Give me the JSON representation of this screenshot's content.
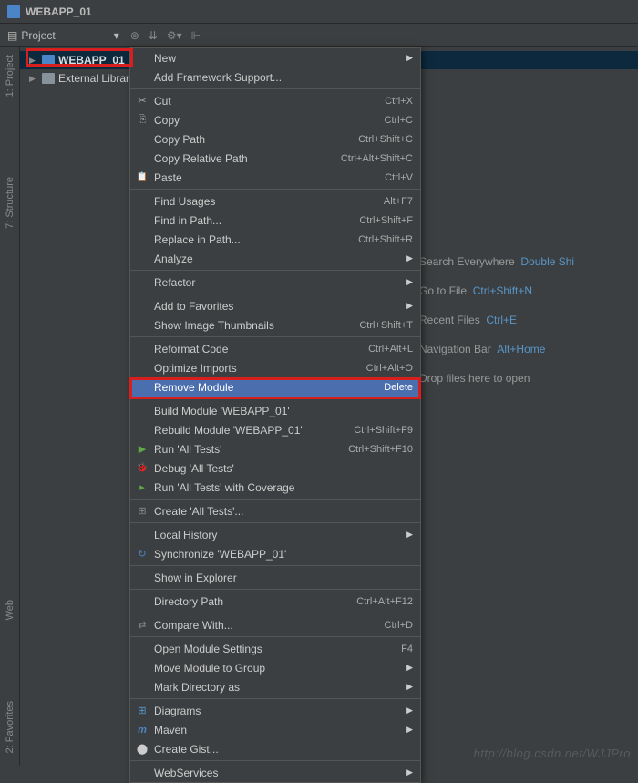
{
  "titlebar": {
    "title": "WEBAPP_01"
  },
  "toolbar": {
    "project_label": "Project"
  },
  "tree": {
    "module": "WEBAPP_01",
    "external": "External Librar"
  },
  "gutter": {
    "project": "1: Project",
    "structure": "7: Structure",
    "web": "Web",
    "favorites": "2: Favorites"
  },
  "content": {
    "search": "Search Everywhere",
    "search_sc": "Double Shi",
    "goto": "Go to File",
    "goto_sc": "Ctrl+Shift+N",
    "recent": "Recent Files",
    "recent_sc": "Ctrl+E",
    "nav": "Navigation Bar",
    "nav_sc": "Alt+Home",
    "drop": "Drop files here to open"
  },
  "menu": {
    "new": "New",
    "addfw": "Add Framework Support...",
    "cut": "Cut",
    "cut_sc": "Ctrl+X",
    "copy": "Copy",
    "copy_sc": "Ctrl+C",
    "copypath": "Copy Path",
    "copypath_sc": "Ctrl+Shift+C",
    "copyrel": "Copy Relative Path",
    "copyrel_sc": "Ctrl+Alt+Shift+C",
    "paste": "Paste",
    "paste_sc": "Ctrl+V",
    "findusages": "Find Usages",
    "findusages_sc": "Alt+F7",
    "findpath": "Find in Path...",
    "findpath_sc": "Ctrl+Shift+F",
    "replacepath": "Replace in Path...",
    "replacepath_sc": "Ctrl+Shift+R",
    "analyze": "Analyze",
    "refactor": "Refactor",
    "addfav": "Add to Favorites",
    "thumbs": "Show Image Thumbnails",
    "thumbs_sc": "Ctrl+Shift+T",
    "reformat": "Reformat Code",
    "reformat_sc": "Ctrl+Alt+L",
    "optimize": "Optimize Imports",
    "optimize_sc": "Ctrl+Alt+O",
    "remove": "Remove Module",
    "remove_sc": "Delete",
    "build": "Build Module 'WEBAPP_01'",
    "rebuild": "Rebuild Module 'WEBAPP_01'",
    "rebuild_sc": "Ctrl+Shift+F9",
    "run": "Run 'All Tests'",
    "run_sc": "Ctrl+Shift+F10",
    "debug": "Debug 'All Tests'",
    "cov": "Run 'All Tests' with Coverage",
    "create": "Create 'All Tests'...",
    "localhist": "Local History",
    "sync": "Synchronize 'WEBAPP_01'",
    "explorer": "Show in Explorer",
    "dirpath": "Directory Path",
    "dirpath_sc": "Ctrl+Alt+F12",
    "compare": "Compare With...",
    "compare_sc": "Ctrl+D",
    "modsettings": "Open Module Settings",
    "modsettings_sc": "F4",
    "movegroup": "Move Module to Group",
    "markdir": "Mark Directory as",
    "diagrams": "Diagrams",
    "maven": "Maven",
    "gist": "Create Gist...",
    "webservices": "WebServices"
  },
  "watermark": "http://blog.csdn.net/WJJPro"
}
